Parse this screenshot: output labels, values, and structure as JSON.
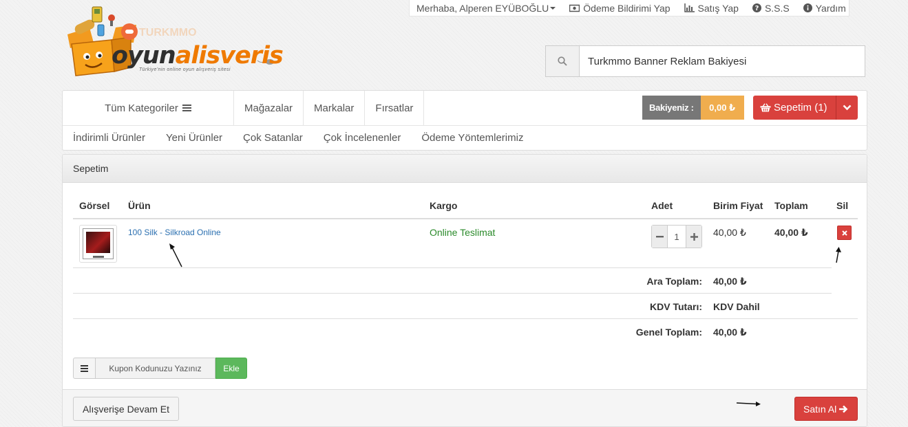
{
  "topbar": {
    "greeting": "Merhaba, Alperen EYÜBOĞLU",
    "payment_notice": "Ödeme Bildirimi Yap",
    "sell": "Satış Yap",
    "faq": "S.S.S",
    "help": "Yardım"
  },
  "logo": {
    "word_dark": "oyun",
    "word_orange": "alisveris",
    "slogan": "Türkiye'nin online oyun alışveriş sitesi"
  },
  "search": {
    "value": "Turkmmo Banner Reklam Bakiyesi",
    "icon": "search-icon"
  },
  "nav": {
    "all_categories": "Tüm Kategoriler",
    "links": [
      "Mağazalar",
      "Markalar",
      "Fırsatlar"
    ],
    "balance_label": "Bakiyeniz :",
    "balance_value": "0,00 ₺",
    "cart_label": "Sepetim (1)",
    "sub_links": [
      "İndirimli Ürünler",
      "Yeni Ürünler",
      "Çok Satanlar",
      "Çok İncelenenler",
      "Ödeme Yöntemlerimiz"
    ]
  },
  "cart": {
    "title": "Sepetim",
    "headers": {
      "image": "Görsel",
      "product": "Ürün",
      "cargo": "Kargo",
      "qty": "Adet",
      "unit_price": "Birim Fiyat",
      "total": "Toplam",
      "delete": "Sil"
    },
    "items": [
      {
        "name": "100 Silk - Silkroad Online",
        "cargo": "Online Teslimat",
        "qty": "1",
        "unit_price": "40,00 ₺",
        "total": "40,00 ₺"
      }
    ],
    "summary": {
      "subtotal_label": "Ara Toplam:",
      "subtotal_value": "40,00 ₺",
      "vat_label": "KDV Tutarı:",
      "vat_value": "KDV Dahil",
      "grand_label": "Genel Toplam:",
      "grand_value": "40,00 ₺"
    },
    "coupon": {
      "placeholder": "Kupon Kodunuzu Yazınız",
      "add_label": "Ekle"
    },
    "continue_label": "Alışverişe Devam Et",
    "buy_label": "Satın Al"
  },
  "colors": {
    "danger": "#d9413d",
    "warning": "#f0ad4e",
    "success": "#5cb85c",
    "brand_orange": "#ef7a00",
    "link": "#2a6fb0"
  }
}
